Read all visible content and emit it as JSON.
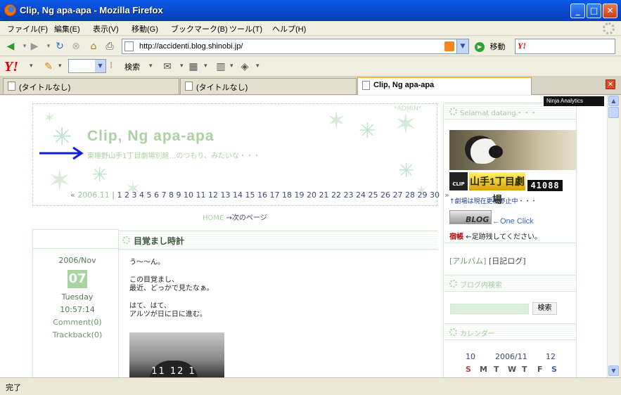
{
  "window": {
    "title": "Clip, Ng apa-apa - Mozilla Firefox",
    "minimize_label": "_",
    "maximize_label": "□",
    "close_label": "✕"
  },
  "menu": {
    "items": [
      "ファイル(F)",
      "編集(E)",
      "表示(V)",
      "移動(G)",
      "ブックマーク(B)",
      "ツール(T)",
      "ヘルプ(H)"
    ]
  },
  "navbar": {
    "url": "http://accidenti.blog.shinobi.jp/",
    "go_label": "移動"
  },
  "yahoo_toolbar": {
    "logo": "Y!",
    "search_label": "検索"
  },
  "tabs": [
    {
      "label": "(タイトルなし)",
      "active": false
    },
    {
      "label": "(タイトルなし)",
      "active": false
    },
    {
      "label": "Clip, Ng apa-apa",
      "active": true
    }
  ],
  "blog": {
    "admin": "*ADMIN*",
    "title": "Clip, Ng apa-apa",
    "subtitle": "東睡野山手1丁目劇場別館…のつもり、みたいな・・・",
    "archive_month": "2006.11",
    "day_links": [
      "1",
      "2",
      "3",
      "4",
      "5",
      "6",
      "7",
      "8",
      "9",
      "10",
      "11",
      "12",
      "13",
      "14",
      "15",
      "16",
      "17",
      "18",
      "19",
      "20",
      "21",
      "22",
      "23",
      "24",
      "25",
      "26",
      "27",
      "28",
      "29",
      "30"
    ],
    "prev_arrow": "«",
    "next_arrow": "»",
    "home_link": "HOME",
    "next_page": "→次のページ"
  },
  "post": {
    "title": "目覚まし時計",
    "month": "2006/Nov",
    "day": "07",
    "weekday": "Tuesday",
    "time": "10:57:14",
    "comments": "Comment(0)",
    "trackbacks": "Trackback(0)",
    "body_lines": [
      "う～～ん。",
      "",
      "この目覚まし、",
      "最近、どっかで見たなぁ。",
      "",
      "はて、はて、",
      "アルツが日に日に進む。"
    ],
    "image_text": "11 12 1"
  },
  "sidebar": {
    "welcome": "Selamat datang・・・",
    "clip_label": "CLIP",
    "theater_label": "山手1丁目劇場",
    "counter": "41088",
    "notice": "↑劇場は現在更新停止中・・・",
    "ninja_blog": "BLOG",
    "one_click": "←One Click",
    "guestbook_badge": "宿帳",
    "guestbook_text": "←足跡残してください。",
    "album_link": "[アルバム]",
    "diary_link": "[日記ログ]",
    "blog_search_title": "ブログ内検索",
    "search_button": "検索",
    "calendar_title": "カレンダー",
    "cal_prev": "10",
    "cal_month": "2006/11",
    "cal_next": "12",
    "weekdays": [
      "S",
      "M",
      "T",
      "W",
      "T",
      "F",
      "S"
    ]
  },
  "ninja_analytics": "Ninja Analytics",
  "status": "完了",
  "colors": {
    "accent_green": "#a9d3a1",
    "title_bar": "#0a5ae8",
    "active_tab_accent": "#f8b840"
  }
}
